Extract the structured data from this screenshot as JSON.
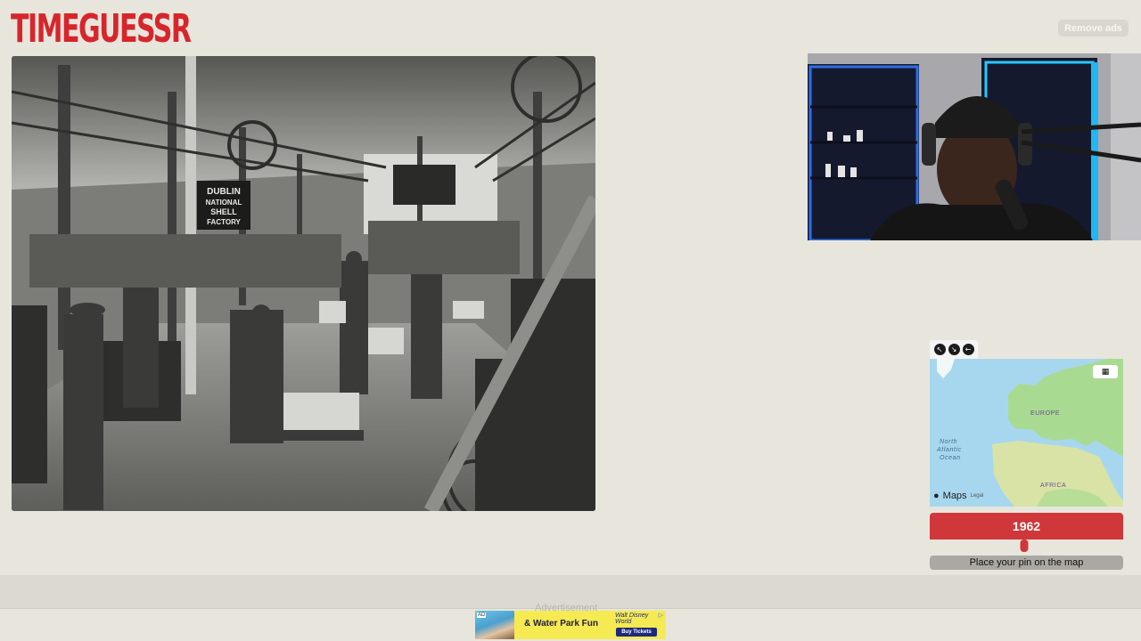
{
  "header": {
    "logo_text": "TIMEGUESSR",
    "remove_ads_label": "Remove ads"
  },
  "photo": {
    "sign_lines": [
      "DUBLIN",
      "NATIONAL",
      "SHELL",
      "FACTORY"
    ]
  },
  "map": {
    "labels": {
      "europe": "EUROPE",
      "africa": "AFRICA",
      "ocean_line1": "North",
      "ocean_line2": "Atlantic",
      "ocean_line3": "Ocean"
    },
    "attribution": "Maps",
    "legal": "Legal",
    "tools": [
      "expand-icon",
      "shrink-icon",
      "pin-icon"
    ],
    "map_type_icon": "map-type-icon"
  },
  "guess": {
    "year": "1962",
    "slider_fraction": 0.49,
    "place_pin_label": "Place your pin on the map"
  },
  "ad": {
    "label": "Advertisement",
    "tag": "AD",
    "headline": "& Water Park Fun",
    "brand": "Walt Disney World",
    "cta": "Buy Tickets"
  },
  "colors": {
    "accent": "#d0373a",
    "background": "#e8e6dc"
  }
}
